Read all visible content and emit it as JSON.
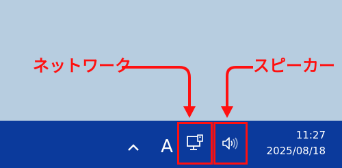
{
  "annotations": {
    "network_label": "ネットワーク",
    "speaker_label": "スピーカー",
    "color": "#ff1010"
  },
  "taskbar": {
    "color": "#0b3a9c",
    "chevron_icon": "chevron-up-icon",
    "ime_indicator": "A",
    "network_icon": "network-monitor-icon",
    "speaker_icon": "speaker-volume-icon",
    "clock": {
      "time": "11:27",
      "date": "2025/08/18"
    }
  },
  "desktop": {
    "color": "#b7cde0"
  }
}
